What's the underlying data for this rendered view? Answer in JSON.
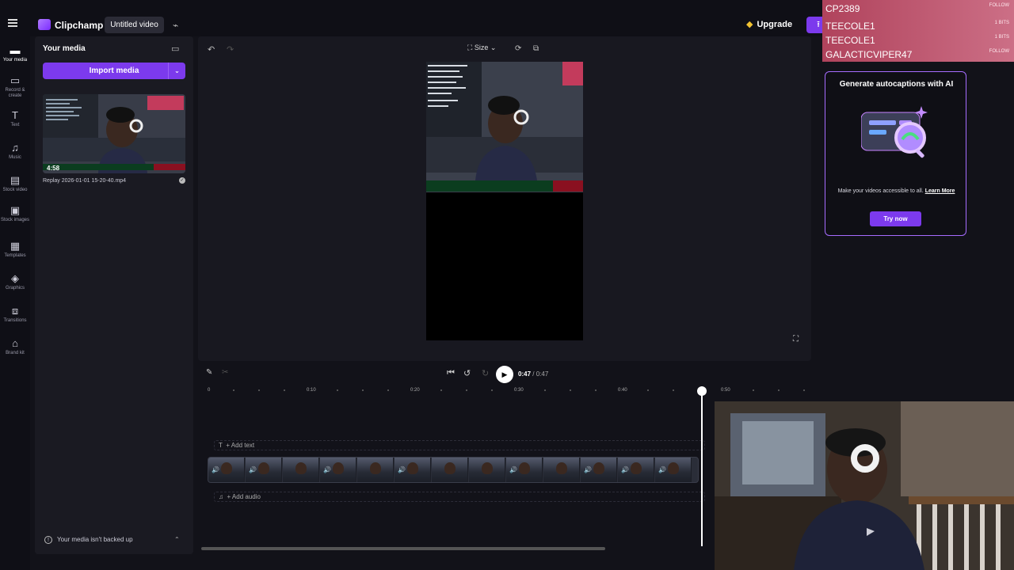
{
  "topbar": {
    "app_name": "Clipchamp",
    "project_title": "Untitled video",
    "upgrade_label": "Upgrade",
    "export_icon": "upload-icon"
  },
  "leftnav": {
    "items": [
      {
        "label": "Your media",
        "icon": "folder-icon",
        "active": true
      },
      {
        "label": "Record & create",
        "icon": "camera-icon"
      },
      {
        "label": "Text",
        "icon": "text-icon"
      },
      {
        "label": "Music",
        "icon": "music-icon"
      },
      {
        "label": "Stock video",
        "icon": "film-icon"
      },
      {
        "label": "Stock images",
        "icon": "image-icon"
      },
      {
        "label": "Templates",
        "icon": "templates-icon"
      },
      {
        "label": "Graphics",
        "icon": "shapes-icon"
      },
      {
        "label": "Transitions",
        "icon": "transition-icon"
      },
      {
        "label": "Brand kit",
        "icon": "brandkit-icon"
      }
    ]
  },
  "media": {
    "title": "Your media",
    "import_label": "Import media",
    "item": {
      "duration": "4:58",
      "filename": "Replay 2026-01-01 15-20-40.mp4"
    },
    "backup_notice": "Your media isn't backed up"
  },
  "preview": {
    "size_label": "Size"
  },
  "timeline": {
    "current_time": "0:47",
    "total_time": "/ 0:47",
    "ticks": [
      "0",
      "0:10",
      "0:20",
      "0:30",
      "0:40",
      "0:50"
    ],
    "add_text": "Add text",
    "add_audio": "Add audio"
  },
  "promo": {
    "title": "Generate autocaptions with AI",
    "text": "Make your videos accessible to all.",
    "link": "Learn More",
    "button": "Try now"
  },
  "stream_overlay": {
    "chat": [
      {
        "name": "CP2389",
        "right": "FOLLOW"
      },
      {
        "name": "TEECOLE1",
        "right": "1 BITS"
      },
      {
        "name": "TEECOLE1",
        "right": "1 BITS"
      },
      {
        "name": "GALACTICVIPER47",
        "right": "FOLLOW"
      }
    ]
  },
  "colors": {
    "accent": "#7c3aed",
    "panel": "#1a1a22",
    "background": "#121219"
  }
}
